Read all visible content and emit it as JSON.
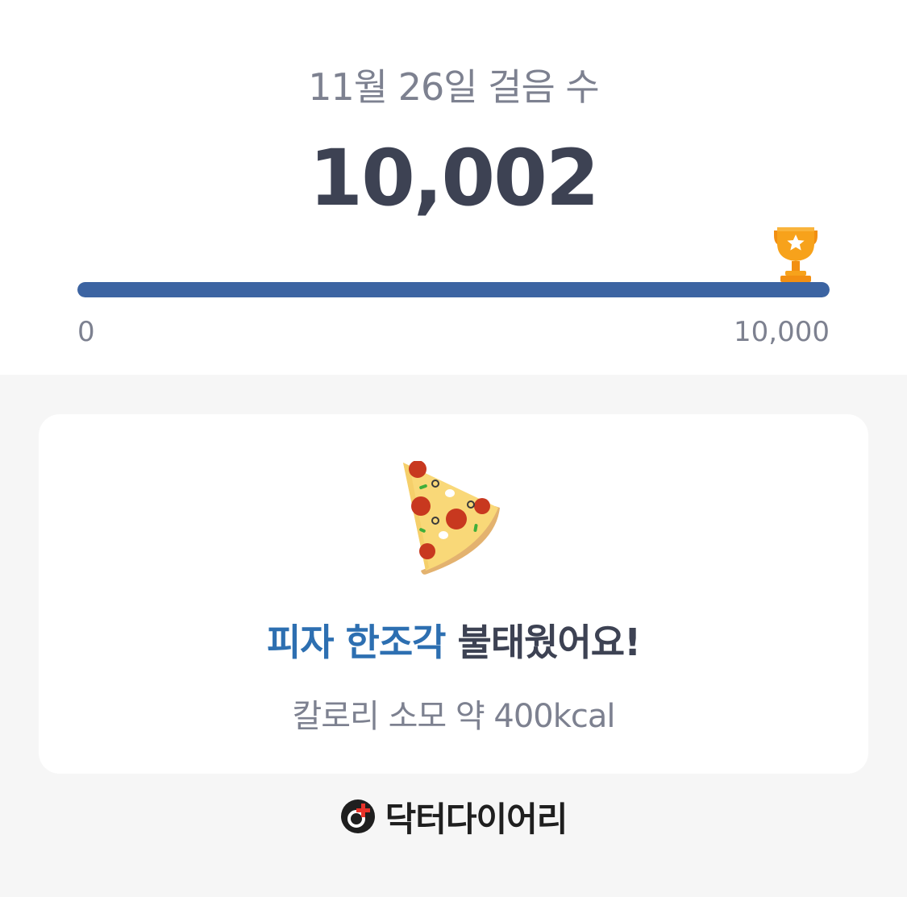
{
  "steps": {
    "title": "11월 26일 걸음 수",
    "count": "10,002",
    "progress": 1.0,
    "min_label": "0",
    "max_label": "10,000",
    "goal_icon": "trophy-icon"
  },
  "card": {
    "food_icon": "pizza-slice-icon",
    "title_highlight": "피자 한조각",
    "title_rest": " 불태웠어요!",
    "calories": "칼로리 소모 약 400kcal"
  },
  "brand": {
    "name": "닥터다이어리",
    "logo_icon": "doctor-diary-logo-icon"
  },
  "colors": {
    "accent": "#2d6fb1",
    "progress": "#3c64a2",
    "trophy": "#f7a21b",
    "text_dark": "#3d4253",
    "text_muted": "#7d8190",
    "logo_red": "#e8332a"
  }
}
